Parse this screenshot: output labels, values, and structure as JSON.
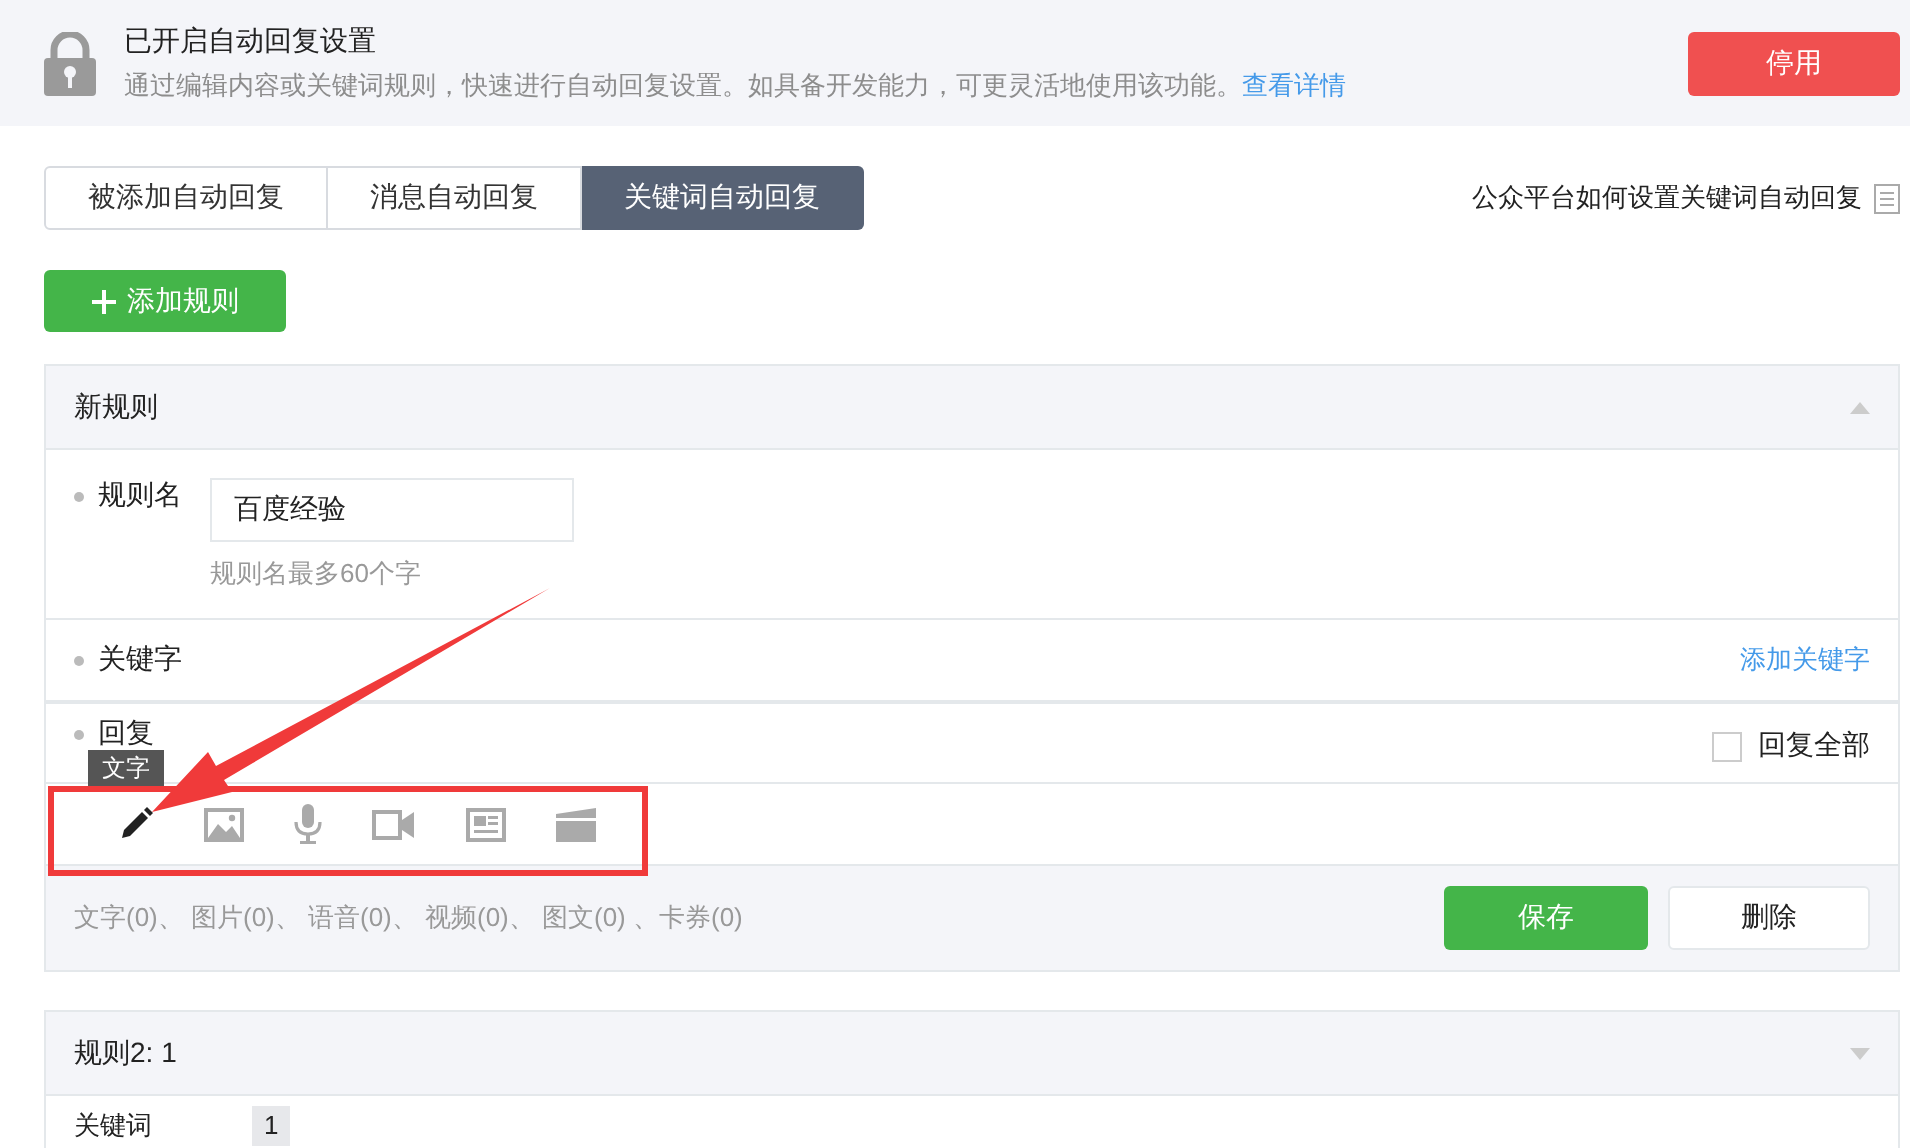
{
  "banner": {
    "title": "已开启自动回复设置",
    "description": "通过编辑内容或关键词规则，快速进行自动回复设置。如具备开发能力，可更灵活地使用该功能。",
    "link": "查看详情",
    "button": "停用"
  },
  "tabs": [
    {
      "label": "被添加自动回复",
      "selected": false
    },
    {
      "label": "消息自动回复",
      "selected": false
    },
    {
      "label": "关键词自动回复",
      "selected": true
    }
  ],
  "help_link": "公众平台如何设置关键词自动回复",
  "add_rule_button": "添加规则",
  "rule": {
    "header": "新规则",
    "name_label": "规则名",
    "name_value": "百度经验",
    "name_hint": "规则名最多60个字",
    "keyword_label": "关键字",
    "add_keyword_link": "添加关键字",
    "reply_label": "回复",
    "reply_all": {
      "label": "回复全部",
      "checked": false
    },
    "tooltip": "文字",
    "tools": [
      {
        "kind": "text",
        "selected": true
      },
      {
        "kind": "image",
        "selected": false
      },
      {
        "kind": "voice",
        "selected": false
      },
      {
        "kind": "video",
        "selected": false
      },
      {
        "kind": "news",
        "selected": false
      },
      {
        "kind": "card",
        "selected": false
      }
    ],
    "counts": "文字(0)、 图片(0)、 语音(0)、 视频(0)、 图文(0) 、卡券(0)",
    "save": "保存",
    "delete": "删除"
  },
  "rule2": {
    "header": "规则2: 1",
    "keyword_label": "关键词",
    "keyword_tag": "1"
  }
}
